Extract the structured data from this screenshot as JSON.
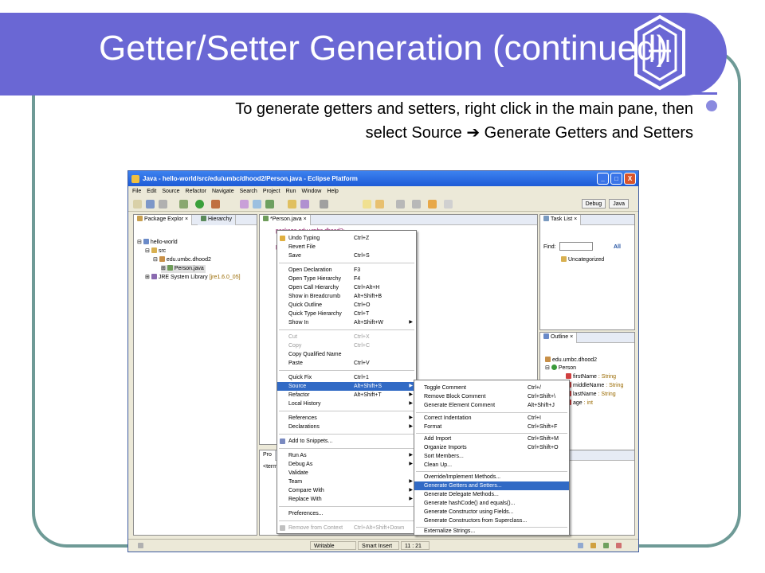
{
  "slide": {
    "title": "Getter/Setter Generation (continued)",
    "subtitle_line1": "To generate getters and setters, right click in the main pane, then",
    "subtitle_line2": "select Source ➔ Generate Getters and Setters"
  },
  "window": {
    "title": "Java - hello-world/src/edu/umbc/dhood2/Person.java - Eclipse Platform",
    "min_glyph": "_",
    "max_glyph": "□",
    "close_glyph": "X"
  },
  "menubar": [
    "File",
    "Edit",
    "Source",
    "Refactor",
    "Navigate",
    "Search",
    "Project",
    "Run",
    "Window",
    "Help"
  ],
  "perspectives": [
    "Debug",
    "Java"
  ],
  "package_explorer": {
    "tab_label": "Package Explor",
    "hierarchy_tab": "Hierarchy",
    "tree": {
      "project": "hello-world",
      "src": "src",
      "package": "edu.umbc.dhood2",
      "file": "Person.java",
      "jre": "JRE System Library",
      "jre_version": "[jre1.6.0_05]"
    }
  },
  "editor": {
    "tab_label": "*Person.java",
    "code_line1": "package edu.umbc.dhood2;",
    "code_line2": "p"
  },
  "task_list": {
    "tab_label": "Task List",
    "find_label": "Find:",
    "all_label": "All",
    "category": "Uncategorized"
  },
  "outline": {
    "tab_label": "Outline",
    "package": "edu.umbc.dhood2",
    "class": "Person",
    "fields": [
      {
        "name": "firstName",
        "type": " : String"
      },
      {
        "name": "middleName",
        "type": " : String"
      },
      {
        "name": "lastName",
        "type": " : String"
      },
      {
        "name": "age",
        "type": " : int"
      }
    ]
  },
  "bottom_pane": {
    "tab_label": "Pro",
    "console_text": "<termi"
  },
  "context_menu": {
    "items": [
      {
        "label": "Undo Typing",
        "shortcut": "Ctrl+Z"
      },
      {
        "label": "Revert File",
        "shortcut": ""
      },
      {
        "label": "Save",
        "shortcut": "Ctrl+S"
      },
      {
        "label": "Open Declaration",
        "shortcut": "F3"
      },
      {
        "label": "Open Type Hierarchy",
        "shortcut": "F4"
      },
      {
        "label": "Open Call Hierarchy",
        "shortcut": "Ctrl+Alt+H"
      },
      {
        "label": "Show in Breadcrumb",
        "shortcut": "Alt+Shift+B"
      },
      {
        "label": "Quick Outline",
        "shortcut": "Ctrl+O"
      },
      {
        "label": "Quick Type Hierarchy",
        "shortcut": "Ctrl+T"
      },
      {
        "label": "Show In",
        "shortcut": "Alt+Shift+W"
      },
      {
        "label": "Cut",
        "shortcut": "Ctrl+X"
      },
      {
        "label": "Copy",
        "shortcut": "Ctrl+C"
      },
      {
        "label": "Copy Qualified Name",
        "shortcut": ""
      },
      {
        "label": "Paste",
        "shortcut": "Ctrl+V"
      },
      {
        "label": "Quick Fix",
        "shortcut": "Ctrl+1"
      },
      {
        "label": "Source",
        "shortcut": "Alt+Shift+S"
      },
      {
        "label": "Refactor",
        "shortcut": "Alt+Shift+T"
      },
      {
        "label": "Local History",
        "shortcut": ""
      },
      {
        "label": "References",
        "shortcut": ""
      },
      {
        "label": "Declarations",
        "shortcut": ""
      },
      {
        "label": "Add to Snippets...",
        "shortcut": ""
      },
      {
        "label": "Run As",
        "shortcut": ""
      },
      {
        "label": "Debug As",
        "shortcut": ""
      },
      {
        "label": "Validate",
        "shortcut": ""
      },
      {
        "label": "Team",
        "shortcut": ""
      },
      {
        "label": "Compare With",
        "shortcut": ""
      },
      {
        "label": "Replace With",
        "shortcut": ""
      },
      {
        "label": "Preferences...",
        "shortcut": ""
      },
      {
        "label": "Remove from Context",
        "shortcut": "Ctrl+Alt+Shift+Down"
      }
    ]
  },
  "source_menu": {
    "items": [
      {
        "label": "Toggle Comment",
        "shortcut": "Ctrl+/"
      },
      {
        "label": "Remove Block Comment",
        "shortcut": "Ctrl+Shift+\\"
      },
      {
        "label": "Generate Element Comment",
        "shortcut": "Alt+Shift+J"
      },
      {
        "label": "Correct Indentation",
        "shortcut": "Ctrl+I"
      },
      {
        "label": "Format",
        "shortcut": "Ctrl+Shift+F"
      },
      {
        "label": "Add Import",
        "shortcut": "Ctrl+Shift+M"
      },
      {
        "label": "Organize Imports",
        "shortcut": "Ctrl+Shift+O"
      },
      {
        "label": "Sort Members...",
        "shortcut": ""
      },
      {
        "label": "Clean Up...",
        "shortcut": ""
      },
      {
        "label": "Override/Implement Methods...",
        "shortcut": ""
      },
      {
        "label": "Generate Getters and Setters...",
        "shortcut": ""
      },
      {
        "label": "Generate Delegate Methods...",
        "shortcut": ""
      },
      {
        "label": "Generate hashCode() and equals()...",
        "shortcut": ""
      },
      {
        "label": "Generate Constructor using Fields...",
        "shortcut": ""
      },
      {
        "label": "Generate Constructors from Superclass...",
        "shortcut": ""
      },
      {
        "label": "Externalize Strings...",
        "shortcut": ""
      }
    ]
  },
  "statusbar": {
    "writable": "Writable",
    "insert_mode": "Smart Insert",
    "position": "11 : 21"
  },
  "colors": {
    "title_bar": "#6a67d4",
    "frame": "#6e9a96",
    "menu_highlight": "#316ac5"
  }
}
